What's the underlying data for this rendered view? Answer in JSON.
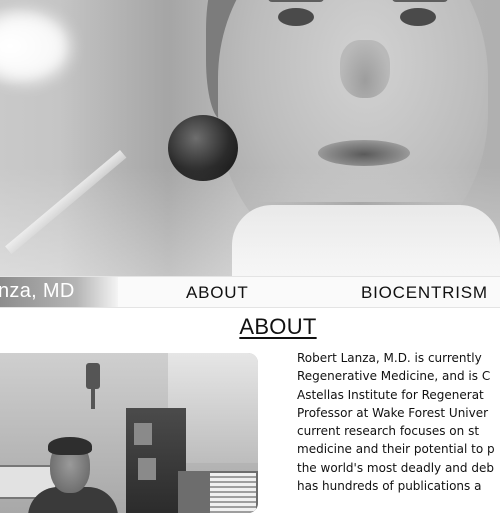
{
  "hero": {
    "image": "portrait-of-man-speaking-at-microphone"
  },
  "nav": {
    "brand": "nza, MD",
    "links": [
      "ABOUT",
      "BIOCENTRISM"
    ]
  },
  "about": {
    "title": "ABOUT",
    "photo": "man-seated-in-office-photo",
    "lines": [
      "Robert Lanza, M.D. is currently",
      "Regenerative Medicine, and is C",
      "Astellas Institute for Regenerat",
      "Professor at Wake Forest Univer",
      "current research focuses on st",
      "medicine and their potential to p",
      "the world's most deadly and deb",
      "has hundreds of publications a"
    ]
  },
  "colors": {
    "text": "#111111",
    "nav_background": "#fafafa",
    "hero_tone": "#bdbdbd"
  }
}
